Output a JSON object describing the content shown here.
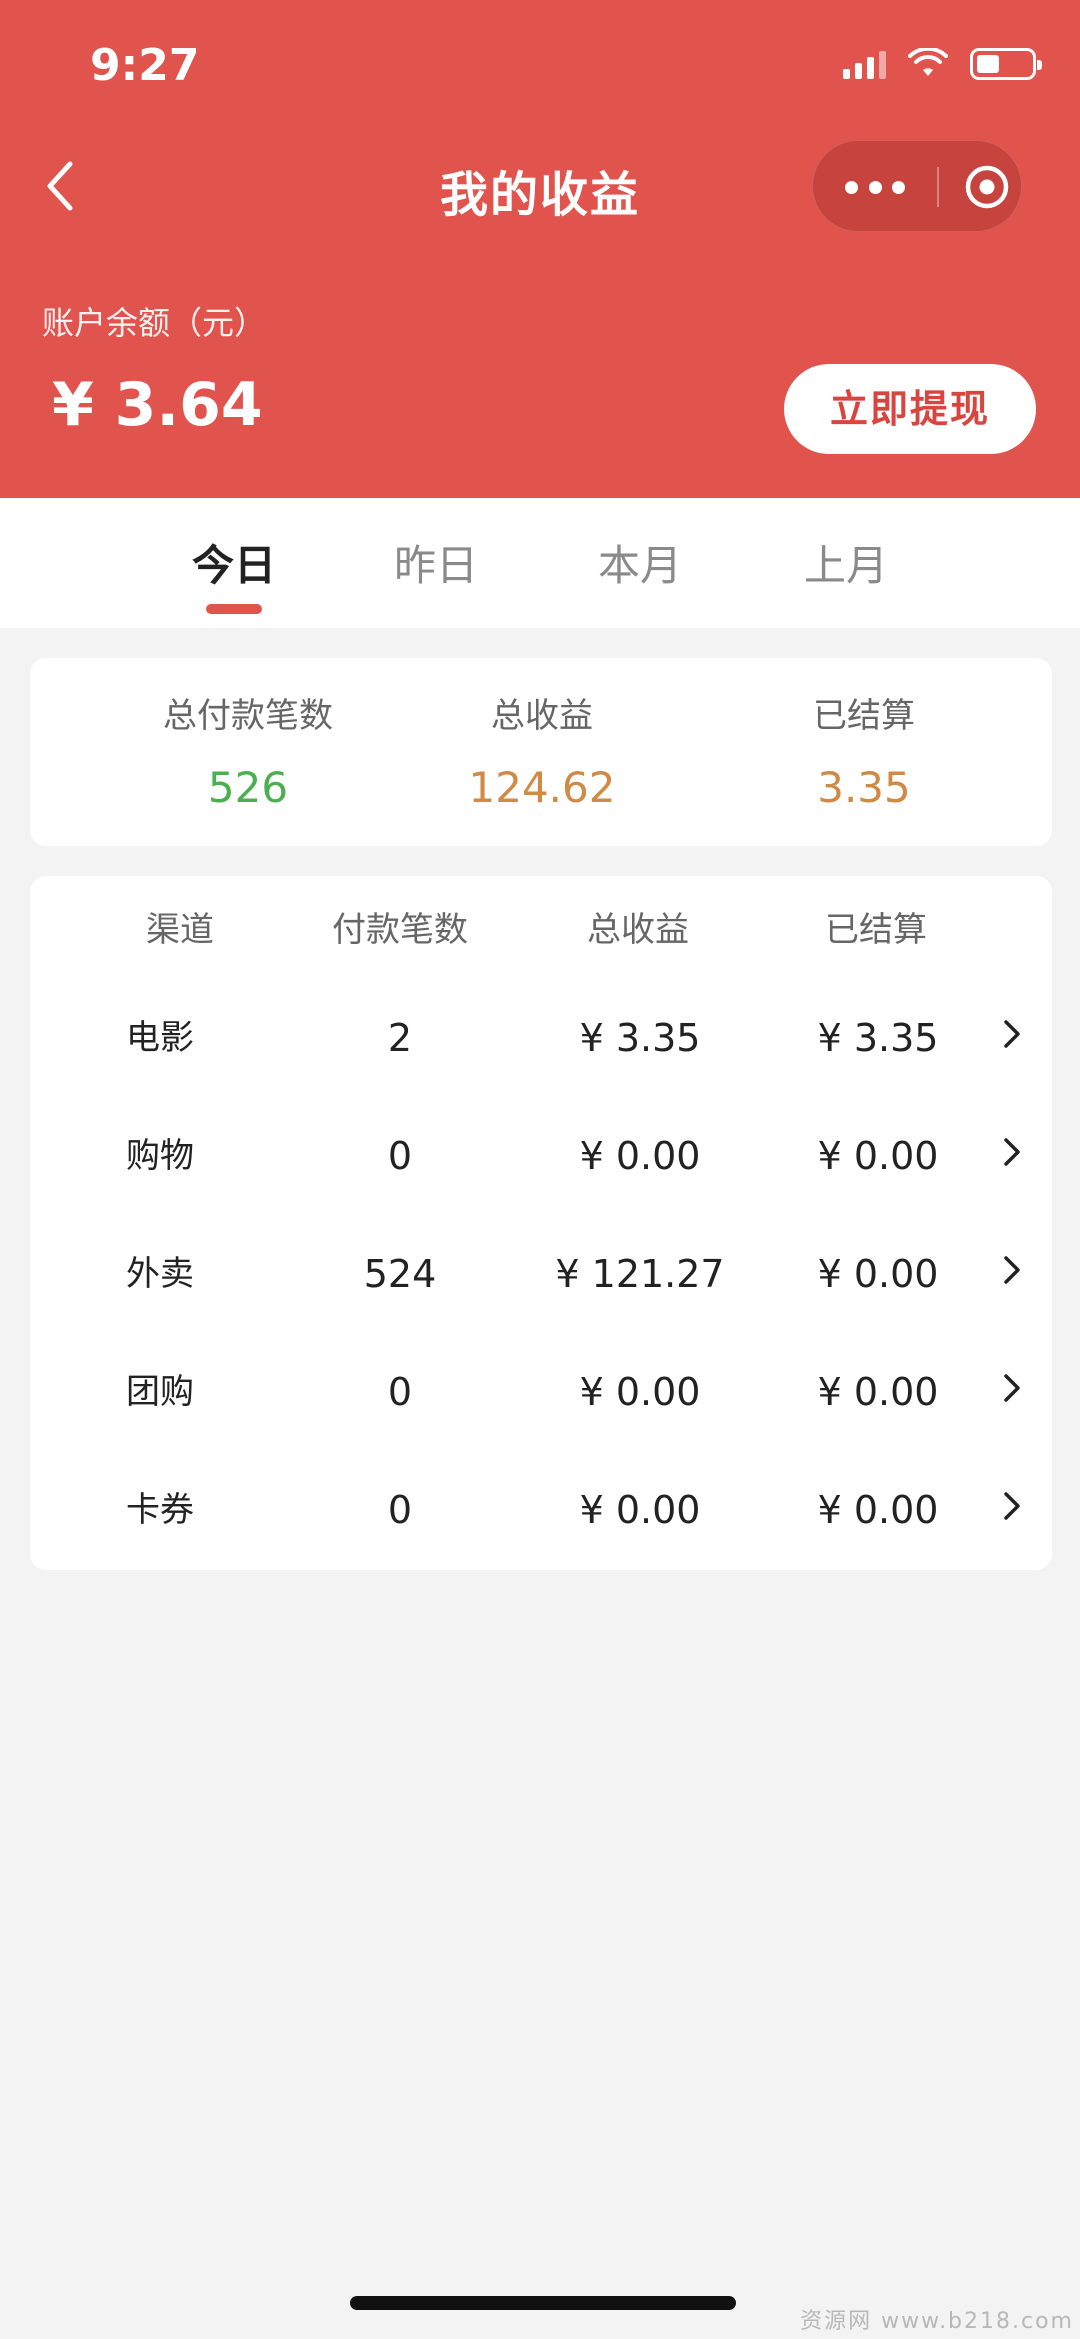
{
  "status_bar": {
    "time": "9:27"
  },
  "nav": {
    "title": "我的收益"
  },
  "balance": {
    "label": "账户余额（元）",
    "value": "¥ 3.64",
    "withdraw_label": "立即提现"
  },
  "tabs": [
    {
      "label": "今日",
      "active": true
    },
    {
      "label": "昨日",
      "active": false
    },
    {
      "label": "本月",
      "active": false
    },
    {
      "label": "上月",
      "active": false
    }
  ],
  "summary": {
    "payments": {
      "label": "总付款笔数",
      "value": "526"
    },
    "income": {
      "label": "总收益",
      "value": "124.62"
    },
    "settled": {
      "label": "已结算",
      "value": "3.35"
    }
  },
  "table": {
    "headers": [
      "渠道",
      "付款笔数",
      "总收益",
      "已结算"
    ],
    "rows": [
      {
        "channel": "电影",
        "payments": "2",
        "income": "¥ 3.35",
        "settled": "¥ 3.35"
      },
      {
        "channel": "购物",
        "payments": "0",
        "income": "¥ 0.00",
        "settled": "¥ 0.00"
      },
      {
        "channel": "外卖",
        "payments": "524",
        "income": "¥ 121.27",
        "settled": "¥ 0.00"
      },
      {
        "channel": "团购",
        "payments": "0",
        "income": "¥ 0.00",
        "settled": "¥ 0.00"
      },
      {
        "channel": "卡券",
        "payments": "0",
        "income": "¥ 0.00",
        "settled": "¥ 0.00"
      }
    ]
  },
  "colors": {
    "primary": "#e1534d",
    "green": "#4caf50",
    "orange": "#d18a45"
  },
  "watermark": "资源网 www.b218.com"
}
